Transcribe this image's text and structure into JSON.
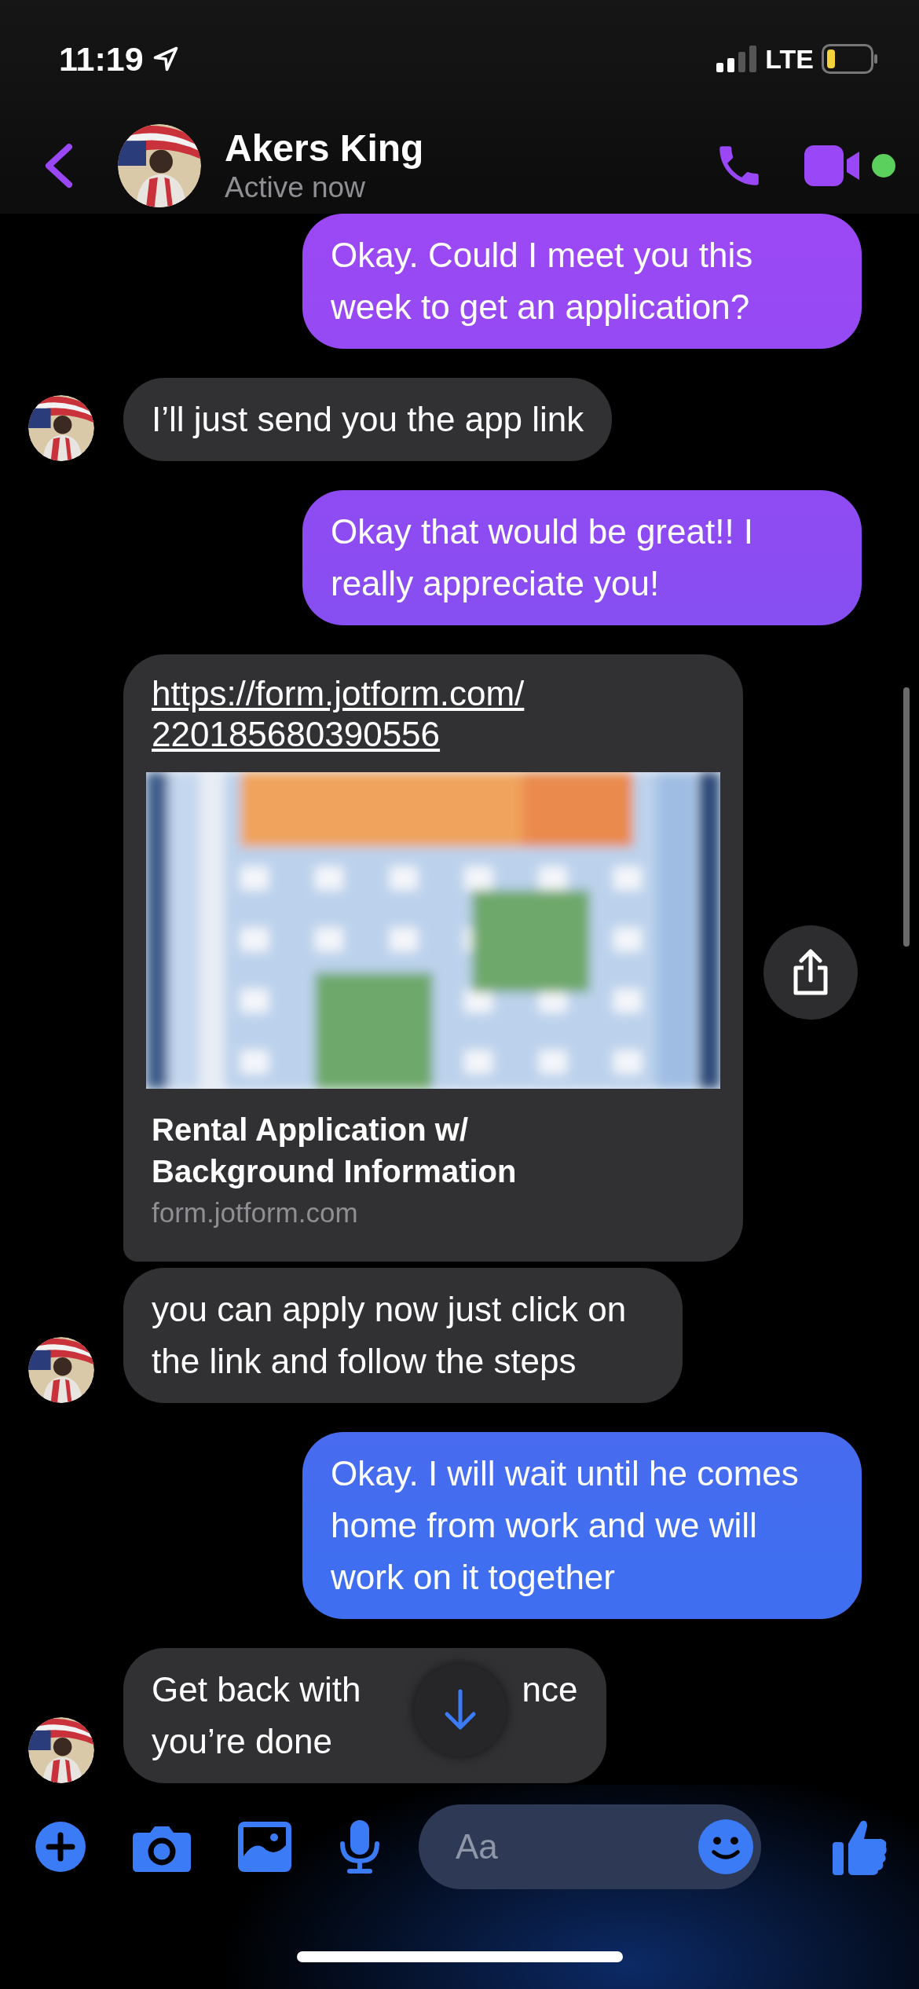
{
  "status_bar": {
    "time": "11:19",
    "network": "LTE"
  },
  "header": {
    "name": "Akers King",
    "status": "Active now",
    "online": true
  },
  "messages": [
    {
      "kind": "sent",
      "text": "Okay. Could I meet you this week to get an application?"
    },
    {
      "kind": "received",
      "text": "I’ll just send you the app link",
      "avatar": true
    },
    {
      "kind": "sent",
      "text": "Okay that would be great!! I really appreciate you!"
    },
    {
      "kind": "link",
      "url_lines": [
        "https://form.jotform.com/",
        "220185680390556"
      ],
      "image": {
        "kind": "picture"
      },
      "title": "Rental Application w/ Background Information",
      "domain": "form.jotform.com",
      "avatar": false
    },
    {
      "kind": "received",
      "text": "you can apply now just click on the link and follow the steps",
      "avatar": true
    },
    {
      "kind": "sent",
      "text": "Okay. I will wait until he comes home from work and we will work on it together"
    },
    {
      "kind": "covered",
      "visible_parts": [
        "Get back with",
        "nce",
        "you’re done"
      ],
      "avatar": true
    }
  ],
  "composer": {
    "placeholder": "Aa"
  }
}
